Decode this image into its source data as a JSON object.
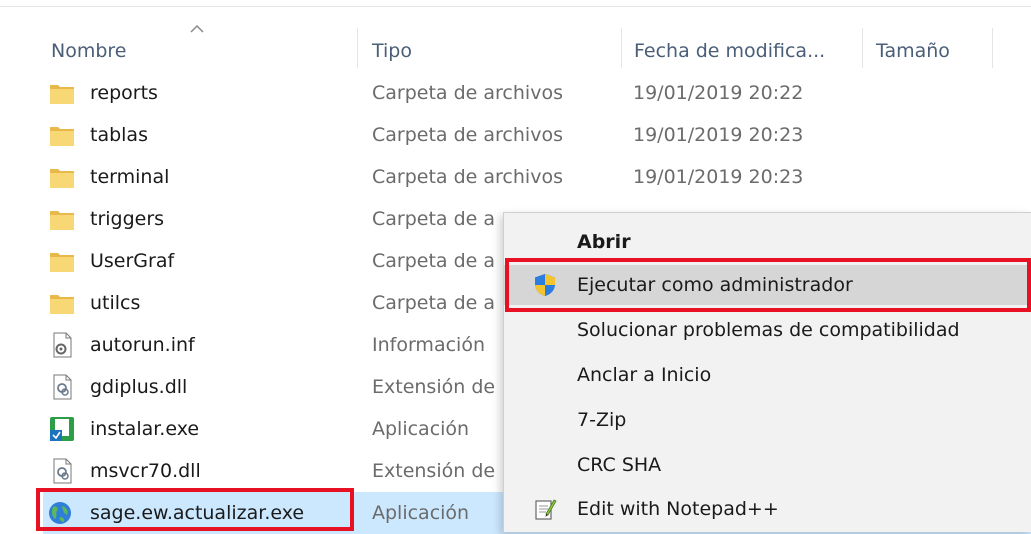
{
  "columns": {
    "name": "Nombre",
    "type": "Tipo",
    "date": "Fecha de modifica...",
    "size": "Tamaño"
  },
  "files": [
    {
      "name": "reports",
      "type": "Carpeta de archivos",
      "date": "19/01/2019 20:22",
      "icon": "folder-icon"
    },
    {
      "name": "tablas",
      "type": "Carpeta de archivos",
      "date": "19/01/2019 20:23",
      "icon": "folder-icon"
    },
    {
      "name": "terminal",
      "type": "Carpeta de archivos",
      "date": "19/01/2019 20:23",
      "icon": "folder-icon"
    },
    {
      "name": "triggers",
      "type": "Carpeta de a",
      "date": "",
      "icon": "folder-icon"
    },
    {
      "name": "UserGraf",
      "type": "Carpeta de a",
      "date": "",
      "icon": "folder-icon"
    },
    {
      "name": "utilcs",
      "type": "Carpeta de a",
      "date": "",
      "icon": "folder-icon"
    },
    {
      "name": "autorun.inf",
      "type": "Información",
      "date": "",
      "icon": "settings-file-icon"
    },
    {
      "name": "gdiplus.dll",
      "type": "Extensión de",
      "date": "",
      "icon": "dll-file-icon"
    },
    {
      "name": "instalar.exe",
      "type": "Aplicación",
      "date": "",
      "icon": "installer-icon"
    },
    {
      "name": "msvcr70.dll",
      "type": "Extensión de",
      "date": "",
      "icon": "dll-file-icon"
    },
    {
      "name": "sage.ew.actualizar.exe",
      "type": "Aplicación",
      "date": "",
      "icon": "globe-app-icon"
    }
  ],
  "context_menu": {
    "items": [
      {
        "label": "Abrir",
        "icon": ""
      },
      {
        "label": "Ejecutar como administrador",
        "icon": "uac-shield-icon"
      },
      {
        "label": "Solucionar problemas de compatibilidad",
        "icon": ""
      },
      {
        "label": "Anclar a Inicio",
        "icon": ""
      },
      {
        "label": "7-Zip",
        "icon": ""
      },
      {
        "label": "CRC SHA",
        "icon": ""
      },
      {
        "label": "Edit with Notepad++",
        "icon": "notepad-plus-plus-icon"
      }
    ]
  },
  "colors": {
    "highlight_box": "#e81123",
    "selection": "#cce8ff",
    "header_text": "#4a5e78",
    "folder": "#f8d775"
  }
}
